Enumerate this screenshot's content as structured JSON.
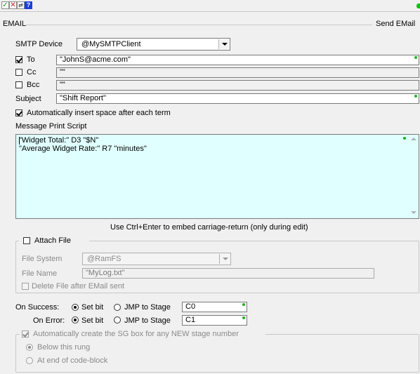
{
  "toolbar": {
    "accept_icon": "check-icon",
    "cancel_icon": "x-icon",
    "translate_icon": "translate-icon",
    "help_label": "?"
  },
  "header": {
    "title": "EMAIL",
    "right_title": "Send EMail"
  },
  "smtp": {
    "label": "SMTP Device",
    "value": "@MySMTPClient"
  },
  "recipients": {
    "to": {
      "label": "To",
      "checked": true,
      "value": "\"JohnS@acme.com\""
    },
    "cc": {
      "label": "Cc",
      "checked": false,
      "value": "\"\""
    },
    "bcc": {
      "label": "Bcc",
      "checked": false,
      "value": "\"\""
    }
  },
  "subject": {
    "label": "Subject",
    "value": "\"Shift Report\""
  },
  "auto_space": {
    "label": "Automatically insert space after each term",
    "checked": true
  },
  "script": {
    "label": "Message Print Script",
    "lines": [
      "\"Widget Total:\" D3 \"$N\"",
      "\"Average Widget Rate:\" R7 \"minutes\""
    ],
    "hint": "Use Ctrl+Enter to embed carriage-return (only during edit)"
  },
  "attach": {
    "label": "Attach File",
    "checked": false,
    "file_system_label": "File System",
    "file_system_value": "@RamFS",
    "file_name_label": "File Name",
    "file_name_value": "\"MyLog.txt\"",
    "delete_label": "Delete File after EMail sent"
  },
  "on_success": {
    "label": "On Success:",
    "set_bit_label": "Set bit",
    "jmp_label": "JMP to Stage",
    "value": "C0",
    "selected": "set_bit"
  },
  "on_error": {
    "label": "On Error:",
    "set_bit_label": "Set bit",
    "jmp_label": "JMP to Stage",
    "value": "C1",
    "selected": "set_bit"
  },
  "auto_sg": {
    "label": "Automatically create the SG box for any NEW stage number",
    "checked": true,
    "option_below": "Below this rung",
    "option_end": "At end of code-block",
    "selected": "below"
  },
  "colors": {
    "script_bg": "#e0ffff",
    "ok_green": "#19b519",
    "help_blue": "#1c3fd1"
  }
}
